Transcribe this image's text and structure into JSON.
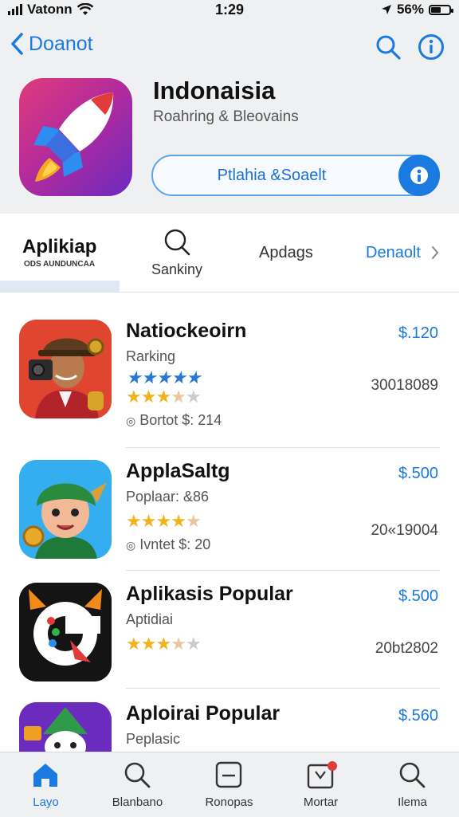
{
  "status": {
    "carrier": "Vatonn",
    "time": "1:29",
    "battery": "56%",
    "battery_level": 0.56
  },
  "nav": {
    "back_label": "Doanot"
  },
  "app": {
    "title": "Indonaisia",
    "subtitle": "Roahring & Bleovains",
    "action_label": "Ptlahia &Soaelt"
  },
  "tabs": [
    {
      "label": "Aplikiap",
      "sublabel": "ODS AUNDUNCAA"
    },
    {
      "label": "Sankiny"
    },
    {
      "label": "Apdags"
    },
    {
      "label": "Denaolt"
    }
  ],
  "apps": [
    {
      "name": "Natiockeoirn",
      "subtitle": "Rarking",
      "rating_line": "Axxxxxxx",
      "rating": 3.5,
      "meta": "Bortot $: 214",
      "price": "$.120",
      "count": "30018089"
    },
    {
      "name": "ApplaSaltg",
      "subtitle": "Poplaar: &86",
      "rating": 4.5,
      "meta": "Ivntet $: 20",
      "price": "$.500",
      "count": "20«19004"
    },
    {
      "name": "Aplikasis Popular",
      "subtitle": "Aptidiai",
      "rating": 3.5,
      "price": "$.500",
      "count": "20bt2802"
    },
    {
      "name": "Aploirai Popular",
      "subtitle": "Peplasic",
      "price": "$.560"
    }
  ],
  "tabbar": [
    {
      "label": "Layo",
      "icon": "home-icon",
      "active": true
    },
    {
      "label": "Blanbano",
      "icon": "search-icon"
    },
    {
      "label": "Ronopas",
      "icon": "updates-icon"
    },
    {
      "label": "Mortar",
      "icon": "notification-icon"
    },
    {
      "label": "Ilema",
      "icon": "search-icon"
    }
  ],
  "colors": {
    "accent": "#1a7ae0",
    "star": "#f2b21b",
    "header_bg": "#eef0f2"
  }
}
